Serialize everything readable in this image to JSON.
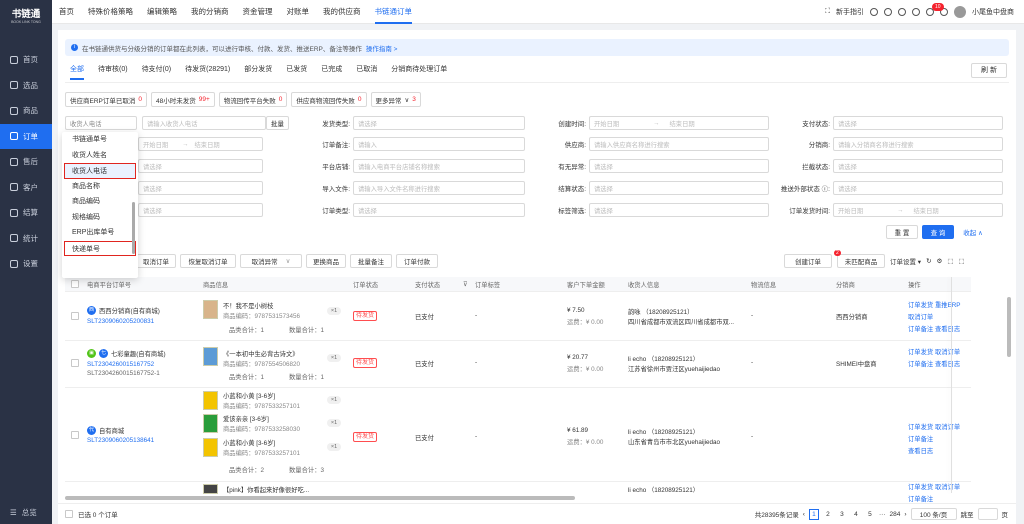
{
  "app": {
    "logo": "书链通",
    "logo_sub": "BOOK LINK TONG"
  },
  "sidebar": {
    "items": [
      {
        "label": "首页"
      },
      {
        "label": "选品"
      },
      {
        "label": "商品"
      },
      {
        "label": "订单"
      },
      {
        "label": "售后"
      },
      {
        "label": "客户"
      },
      {
        "label": "结算"
      },
      {
        "label": "统计"
      },
      {
        "label": "设置"
      }
    ],
    "bottom": "总览"
  },
  "topnav": {
    "items": [
      "首页",
      "特殊价格策略",
      "编辑策略",
      "我的分销商",
      "资金管理",
      "对账单",
      "我的供应商",
      "书链通订单"
    ],
    "guide": "新手指引",
    "badge": "10",
    "user": "小尾鱼中盘商"
  },
  "notice": {
    "text": "在书链通供货与分级分销的订单都在此列表，可以进行审核、付款、发货、推送ERP、备注等操作",
    "link": "操作指南 >"
  },
  "tabs": [
    "全部",
    "待审核(0)",
    "待支付(0)",
    "待发货(28291)",
    "部分发货",
    "已发货",
    "已完成",
    "已取消",
    "分销商待处理订单"
  ],
  "refresh": "刷 新",
  "quick_tags": [
    {
      "label": "供应商ERP订单已取消",
      "count": "0"
    },
    {
      "label": "48小时未发货",
      "count": "99+"
    },
    {
      "label": "物流回传平台失败",
      "count": "0"
    },
    {
      "label": "供应商物流回传失败",
      "count": "0"
    },
    {
      "label": "更多异常",
      "count": "3"
    }
  ],
  "filters": {
    "search_type": "收货人电话",
    "search_ph": "请输入收货人电话",
    "batch": "批量",
    "ship_type": "发货类型:",
    "select_ph": "请选择",
    "create_time": "创建时间:",
    "start": "开始日期",
    "end": "结束日期",
    "pay_status": "支付状态:",
    "start2": "开始日期",
    "end2": "结束日期",
    "remark": "订单备注:",
    "input_ph": "请输入",
    "supplier": "供应商:",
    "supplier_ph": "请输入供应商名称进行搜索",
    "distributor": "分销商:",
    "distributor_ph": "请输入分销商名称进行搜索",
    "shop": "平台店铺:",
    "shop_ph": "请输入电商平台店铺名称搜索",
    "abnormal": "有无异常:",
    "intercept": "拦截状态:",
    "import": "导入文件:",
    "import_ph": "请输入导入文件名称进行搜索",
    "settle": "结算状态:",
    "push": "推送外部状态 ⓘ:",
    "order_type": "订单类型:",
    "label_filter": "标签筛选:",
    "ship_time": "订单发货时间:",
    "reset": "重 置",
    "query": "查 询",
    "collapse": "收起 ∧"
  },
  "dropdown": [
    "书链通单号",
    "收货人姓名",
    "收货人电话",
    "商品名称",
    "商品编码",
    "规格编码",
    "ERP出库单号",
    "快递单号"
  ],
  "actions": {
    "cancel": "取消订单",
    "recover": "恢复取消订单",
    "cancel_abn": "取消异常",
    "change": "更换商品",
    "batch_remark": "批量备注",
    "pay": "订单付款",
    "create": "创建订单",
    "unmatched": "未匹配商品",
    "unmatched_badge": "2",
    "settings": "订单设置 ▾"
  },
  "columns": [
    "电商平台订单号",
    "商品信息",
    "订单状态",
    "支付状态",
    "订单标签",
    "客户下单金额",
    "收货人信息",
    "物流信息",
    "分销商",
    "操作"
  ],
  "rows": [
    {
      "shop": "西西分销商(自有商城)",
      "shop_icon": "西",
      "order": "SLT2309060205200831",
      "items": [
        {
          "name": "不！我不是小树枝",
          "code": "商品编码：9787531573456",
          "qty": "×1"
        }
      ],
      "count": "品类合计：1",
      "total": "数量合计：1",
      "status": "待发货",
      "pay": "已支付",
      "label": "-",
      "amount": "¥ 7.50",
      "freight": "运费：¥ 0.00",
      "rcv_name": "韵咏 （18208925121）",
      "rcv_addr": "四川省成都市双流区四川省成都市双...",
      "logi": "-",
      "dist": "西西分销商",
      "ops": [
        "订单发货",
        "重推ERP",
        "取消订单",
        "订单备注",
        "查看日志"
      ]
    },
    {
      "shop": "七彩童趣(自有商城)",
      "shop_icon": "七",
      "order": "SLT2304260015167752",
      "order2": "SLT2304260015167752-1",
      "items": [
        {
          "name": "《一本初中生必背古诗文》",
          "code": "商品编码：9787554506820",
          "qty": "×1"
        }
      ],
      "count": "品类合计：1",
      "total": "数量合计：1",
      "status": "待发货",
      "pay": "已支付",
      "label": "-",
      "amount": "¥ 20.77",
      "freight": "运费：¥ 0.00",
      "rcv_name": "li echo （18208925121）",
      "rcv_addr": "江苏省徐州市贾汪区yuehaijiedao",
      "logi": "-",
      "dist": "SHIMEI中盘商",
      "ops": [
        "订单发货",
        "取消订单",
        "订单备注",
        "查看日志"
      ]
    },
    {
      "shop": "自有商城",
      "shop_icon": "代",
      "order": "SLT2309060205138641",
      "items": [
        {
          "name": "小蓝和小黄 [3-6岁]",
          "code": "商品编码：9787533257101",
          "qty": "×1"
        },
        {
          "name": "爱该亲亲 [3-6岁]",
          "code": "商品编码：9787533258030",
          "qty": "×1"
        },
        {
          "name": "小蓝和小黄 [3-6岁]",
          "code": "商品编码：9787533257101",
          "qty": "×1"
        }
      ],
      "count": "品类合计：2",
      "total": "数量合计：3",
      "status": "待发货",
      "pay": "已支付",
      "label": "-",
      "amount": "¥ 61.89",
      "freight": "运费：¥ 0.00",
      "rcv_name": "li echo （18208925121）",
      "rcv_addr": "山东省青岛市市北区yuehaijiedao",
      "logi": "-",
      "dist": "",
      "ops": [
        "订单发货",
        "取消订单",
        "订单备注",
        "查看日志"
      ]
    },
    {
      "shop": "",
      "items": [
        {
          "name": "【pink】你看起来好像很好吃...",
          "code": "",
          "qty": ""
        }
      ],
      "rcv_name": "li echo （18208925121）",
      "ops": [
        "订单发货",
        "取消订单",
        "订单备注"
      ]
    }
  ],
  "footer": {
    "selected": "已选 0 个订单",
    "total": "共28395条记录",
    "pages": [
      "1",
      "2",
      "3",
      "4",
      "5",
      "···",
      "284"
    ],
    "page_size": "100 条/页",
    "jump": "跳至",
    "page_unit": "页"
  }
}
